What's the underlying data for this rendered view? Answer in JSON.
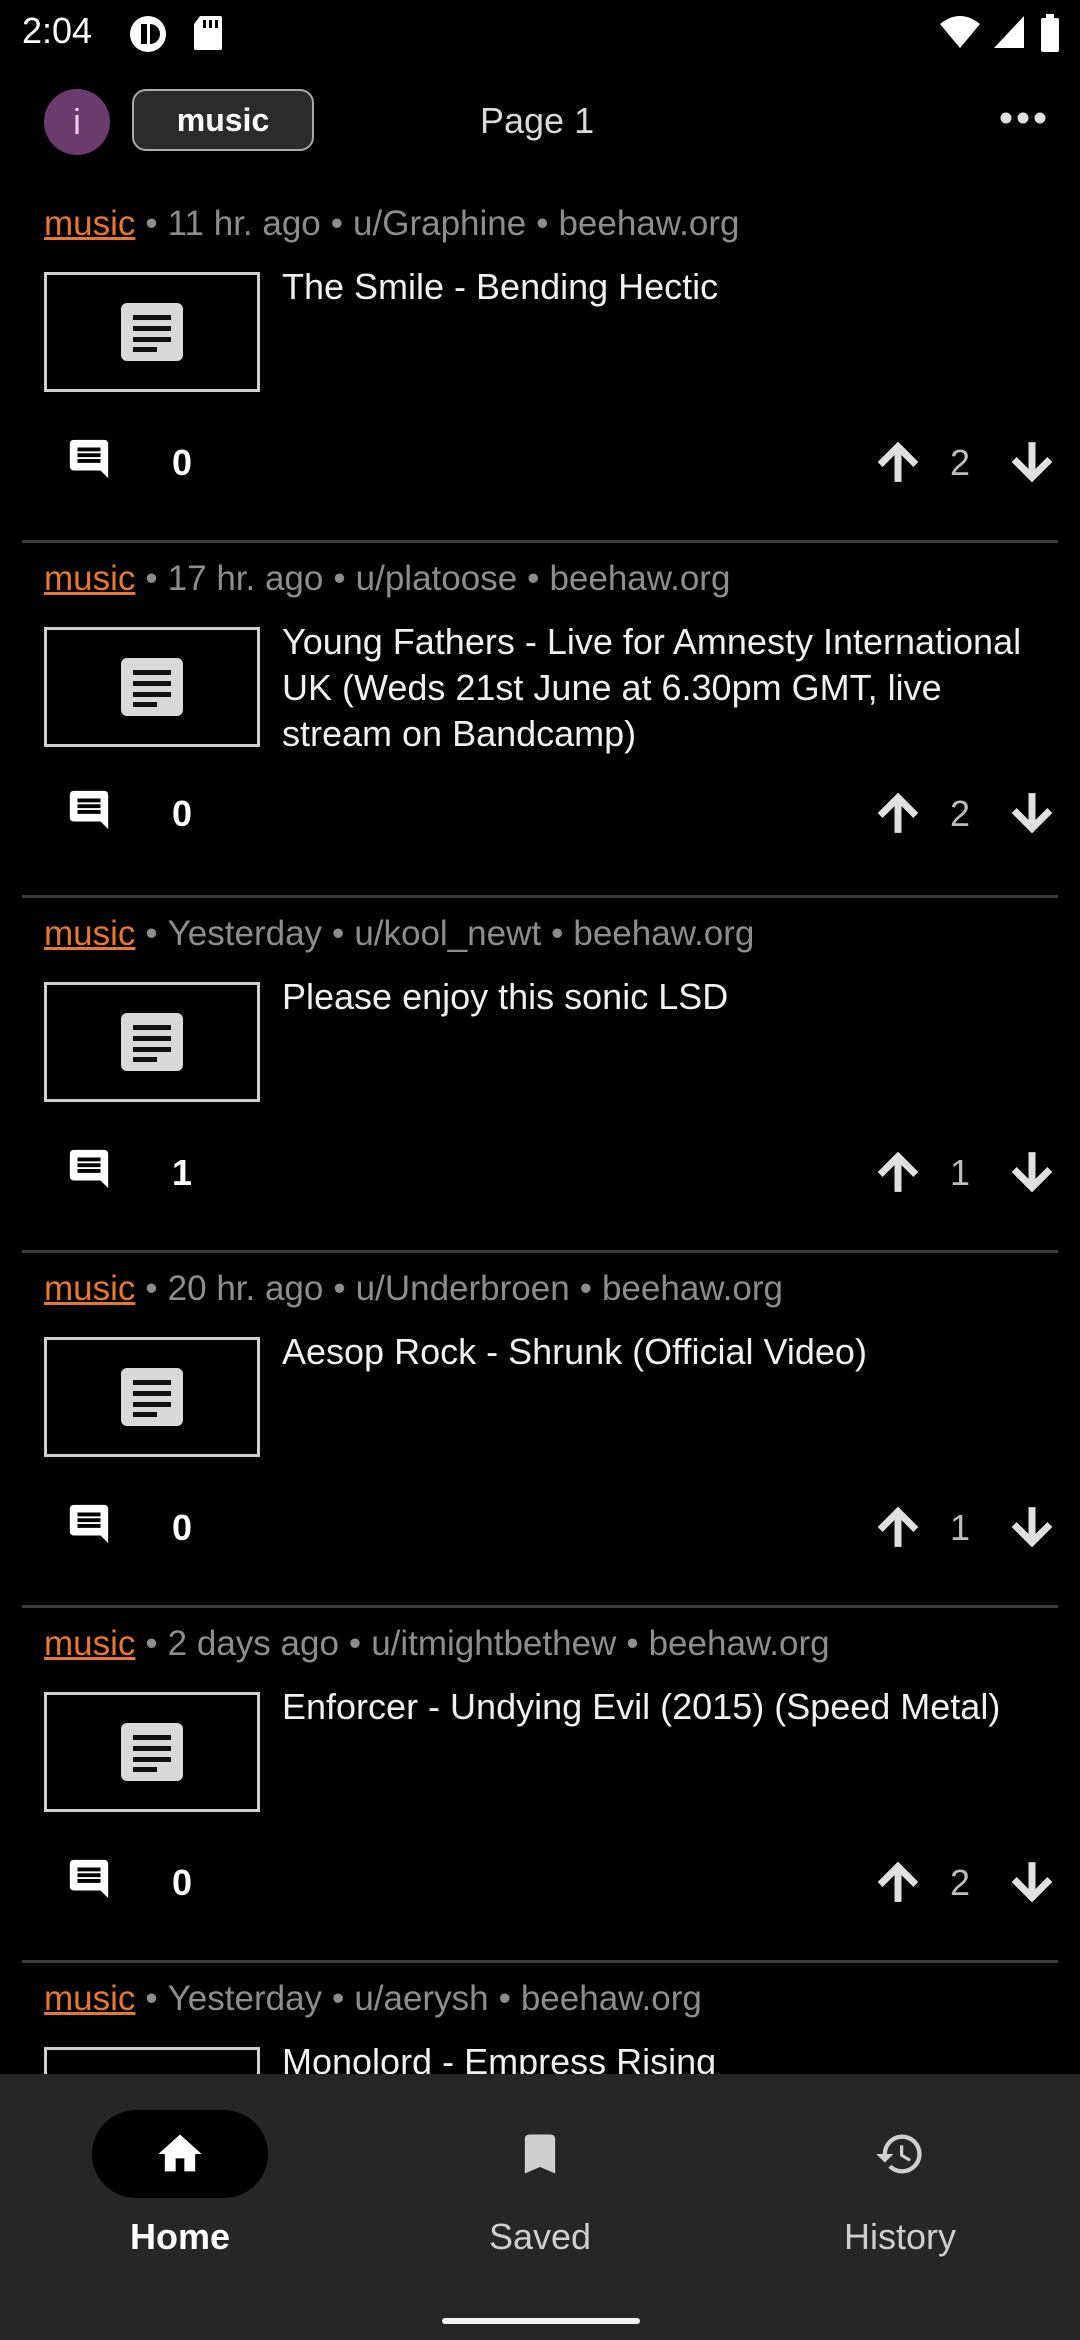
{
  "status_bar": {
    "time": "2:04"
  },
  "top_bar": {
    "avatar_letter": "i",
    "community_chip": "music",
    "page_label": "Page 1"
  },
  "posts": [
    {
      "community": "music",
      "time": "11 hr. ago",
      "user": "u/Graphine",
      "instance": "beehaw.org",
      "title": "The Smile - Bending Hectic",
      "comments": "0",
      "score": "2"
    },
    {
      "community": "music",
      "time": "17 hr. ago",
      "user": "u/platoose",
      "instance": "beehaw.org",
      "title": "Young Fathers - Live for Amnesty International UK (Weds 21st June at 6.30pm GMT, live stream on Bandcamp)",
      "comments": "0",
      "score": "2"
    },
    {
      "community": "music",
      "time": "Yesterday",
      "user": "u/kool_newt",
      "instance": "beehaw.org",
      "title": "Please enjoy this sonic LSD",
      "comments": "1",
      "score": "1"
    },
    {
      "community": "music",
      "time": "20 hr. ago",
      "user": "u/Underbroen",
      "instance": "beehaw.org",
      "title": "Aesop Rock - Shrunk (Official Video)",
      "comments": "0",
      "score": "1"
    },
    {
      "community": "music",
      "time": "2 days ago",
      "user": "u/itmightbethew",
      "instance": "beehaw.org",
      "title": "Enforcer - Undying Evil (2015) (Speed Metal)",
      "comments": "0",
      "score": "2"
    },
    {
      "community": "music",
      "time": "Yesterday",
      "user": "u/aerysh",
      "instance": "beehaw.org",
      "title": "Monolord - Empress Rising",
      "comments": "",
      "score": ""
    }
  ],
  "bottom_nav": {
    "items": [
      {
        "label": "Home",
        "icon": "home-icon",
        "active": true
      },
      {
        "label": "Saved",
        "icon": "bookmark-icon",
        "active": false
      },
      {
        "label": "History",
        "icon": "history-icon",
        "active": false
      }
    ]
  },
  "colors": {
    "accent_community": "#e8772f",
    "background": "#000000",
    "nav_background": "#262626"
  }
}
